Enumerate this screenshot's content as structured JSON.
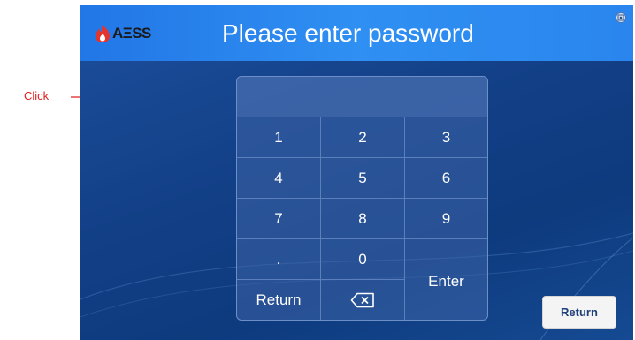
{
  "annotation": {
    "label": "Click",
    "color": "#e02020"
  },
  "header": {
    "logo_text": "AΞSS",
    "title": "Please enter password"
  },
  "keypad": {
    "rows": [
      [
        "1",
        "2",
        "3"
      ],
      [
        "4",
        "5",
        "6"
      ],
      [
        "7",
        "8",
        "9"
      ]
    ],
    "dot": ".",
    "zero": "0",
    "enter": "Enter",
    "return": "Return",
    "backspace_icon": "backspace-icon"
  },
  "footer": {
    "return_label": "Return"
  },
  "colors": {
    "topbar": "#2a86ee",
    "screen": "#123f86",
    "logo_flame": "#e3352b"
  }
}
